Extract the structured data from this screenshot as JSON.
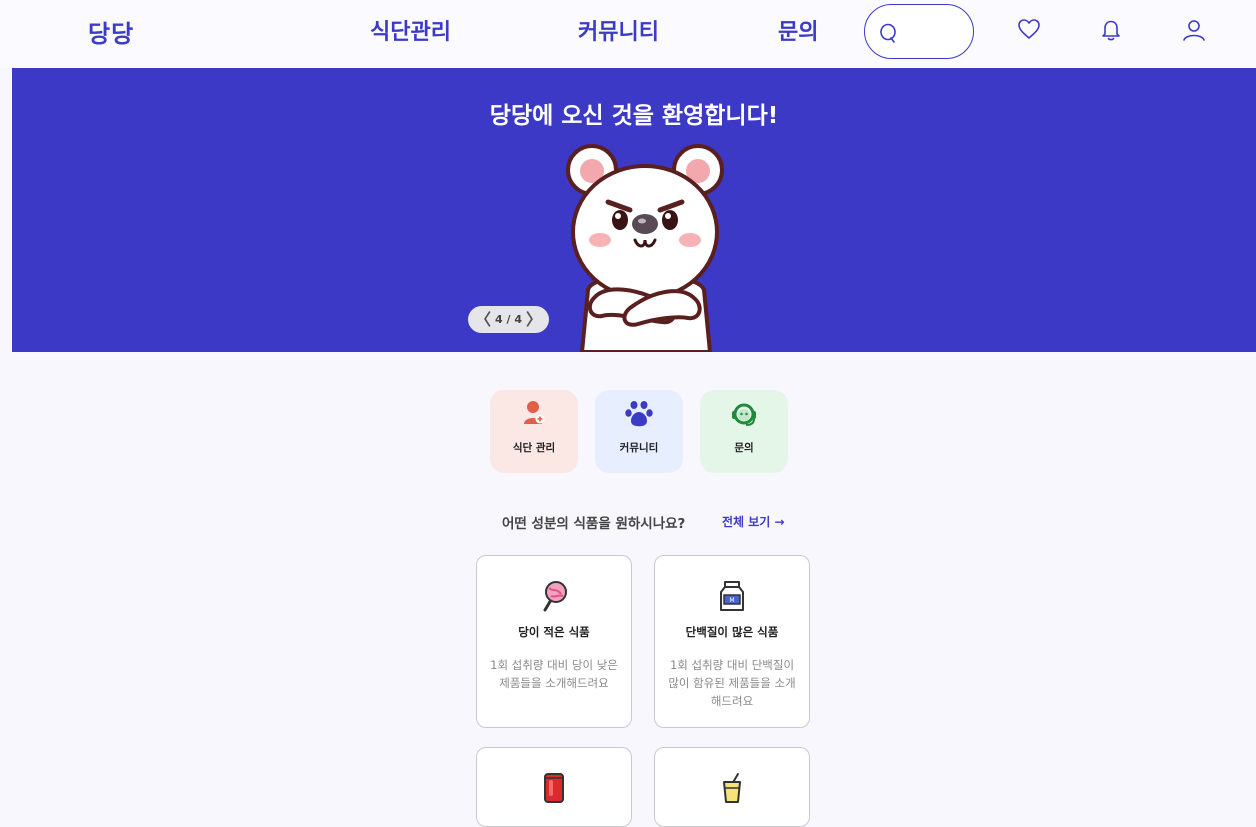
{
  "header": {
    "logo": "당당",
    "nav": [
      "식단관리",
      "커뮤니티",
      "문의"
    ]
  },
  "banner": {
    "title": "당당에 오신 것을 환영합니다!",
    "page_indicator": "4 / 4",
    "progress": {
      "current": 4,
      "total": 4
    }
  },
  "quick_menu": [
    {
      "label": "식단 관리",
      "icon": "user-plus-icon",
      "bg": "#fbe7e4",
      "color": "#e06047"
    },
    {
      "label": "커뮤니티",
      "icon": "paw-icon",
      "bg": "#e7efff",
      "color": "#3b3bc8"
    },
    {
      "label": "문의",
      "icon": "support-headset-icon",
      "bg": "#e4f6e8",
      "color": "#1f8a3c"
    }
  ],
  "section": {
    "title": "어떤 성분의 식품을 원하시나요?",
    "view_all": "전체 보기 →"
  },
  "cards": [
    {
      "title": "당이 적은 식품",
      "desc": "1회 섭취량 대비 당이 낮은 제품들을 소개해드려요",
      "icon": "lollipop-icon"
    },
    {
      "title": "단백질이 많은 식품",
      "desc": "1회 섭취량 대비 단백질이 많이 함유된 제품들을 소개해드려요",
      "icon": "milk-carton-icon"
    },
    {
      "title": "",
      "desc": "",
      "icon": "soda-can-icon"
    },
    {
      "title": "",
      "desc": "",
      "icon": "drink-cup-icon"
    }
  ],
  "colors": {
    "brand": "#3b3bc8",
    "banner": "#3d39c7"
  }
}
